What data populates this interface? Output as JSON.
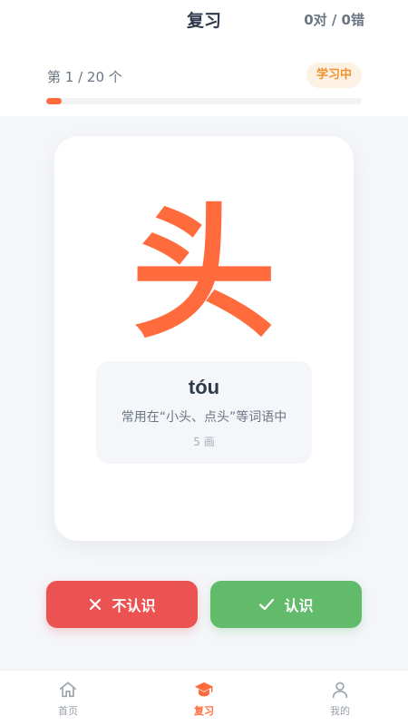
{
  "header": {
    "title": "复习",
    "score": "0对 / 0错",
    "progress_text": "第 1 / 20 个",
    "status_badge": "学习中",
    "progress": {
      "current": 1,
      "total": 20,
      "fraction": 0.05
    }
  },
  "card": {
    "character": "头",
    "pinyin": "tóu",
    "example": "常用在“小头、点头”等词语中",
    "strokes": "5 画"
  },
  "actions": {
    "unknown_label": "不认识",
    "known_label": "认识"
  },
  "nav": {
    "items": [
      {
        "label": "首页",
        "icon": "home-icon",
        "active": false
      },
      {
        "label": "复习",
        "icon": "graduation-cap-icon",
        "active": true
      },
      {
        "label": "我的",
        "icon": "user-icon",
        "active": false
      }
    ]
  },
  "colors": {
    "accent": "#ff6b3d",
    "badge_text": "#f0912e",
    "badge_bg": "#fdf1e4",
    "danger": "#eb5252",
    "success": "#62bb6a"
  }
}
